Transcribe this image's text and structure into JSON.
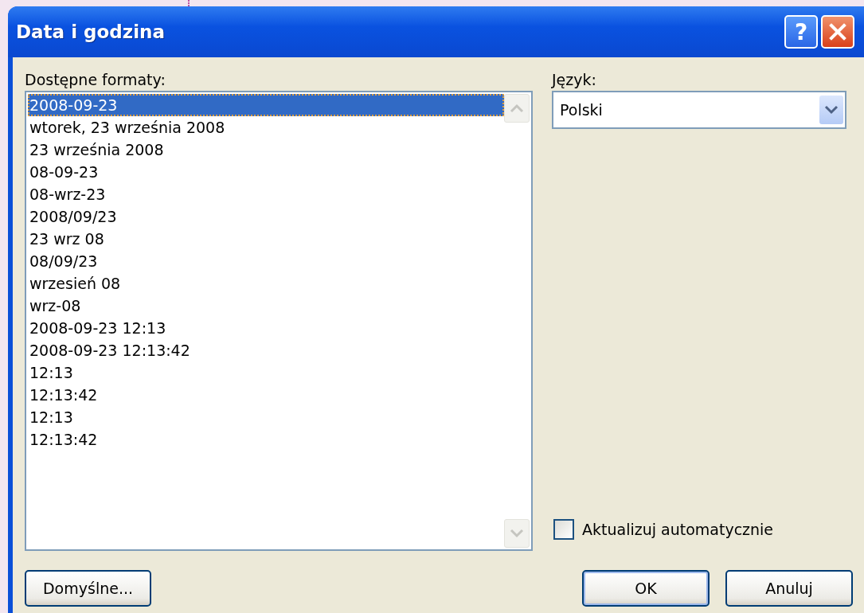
{
  "window": {
    "title": "Data i godzina",
    "help_glyph": "?"
  },
  "formats": {
    "label": "Dostępne formaty:",
    "items": [
      {
        "text": "2008-09-23",
        "selected": true
      },
      {
        "text": "wtorek, 23 września 2008",
        "selected": false
      },
      {
        "text": "23 września 2008",
        "selected": false
      },
      {
        "text": "08-09-23",
        "selected": false
      },
      {
        "text": "08-wrz-23",
        "selected": false
      },
      {
        "text": "2008/09/23",
        "selected": false
      },
      {
        "text": "23 wrz 08",
        "selected": false
      },
      {
        "text": "08/09/23",
        "selected": false
      },
      {
        "text": "wrzesień 08",
        "selected": false
      },
      {
        "text": "wrz-08",
        "selected": false
      },
      {
        "text": "2008-09-23 12:13",
        "selected": false
      },
      {
        "text": "2008-09-23 12:13:42",
        "selected": false
      },
      {
        "text": "12:13",
        "selected": false
      },
      {
        "text": "12:13:42",
        "selected": false
      },
      {
        "text": "12:13",
        "selected": false
      },
      {
        "text": "12:13:42",
        "selected": false
      }
    ]
  },
  "language": {
    "label": "Język:",
    "value": "Polski"
  },
  "auto_update": {
    "label": "Aktualizuj automatycznie",
    "checked": false
  },
  "buttons": {
    "defaults": "Domyślne...",
    "ok": "OK",
    "cancel": "Anuluj"
  }
}
